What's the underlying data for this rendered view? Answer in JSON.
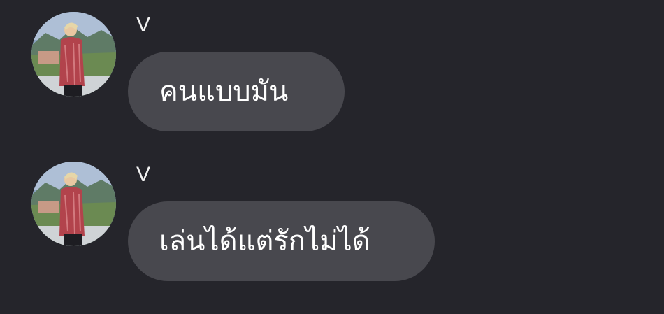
{
  "chat": {
    "messages": [
      {
        "sender": "V",
        "text": "คนแบบมัน"
      },
      {
        "sender": "V",
        "text": "เล่นได้แต่รักไม่ได้"
      }
    ]
  }
}
